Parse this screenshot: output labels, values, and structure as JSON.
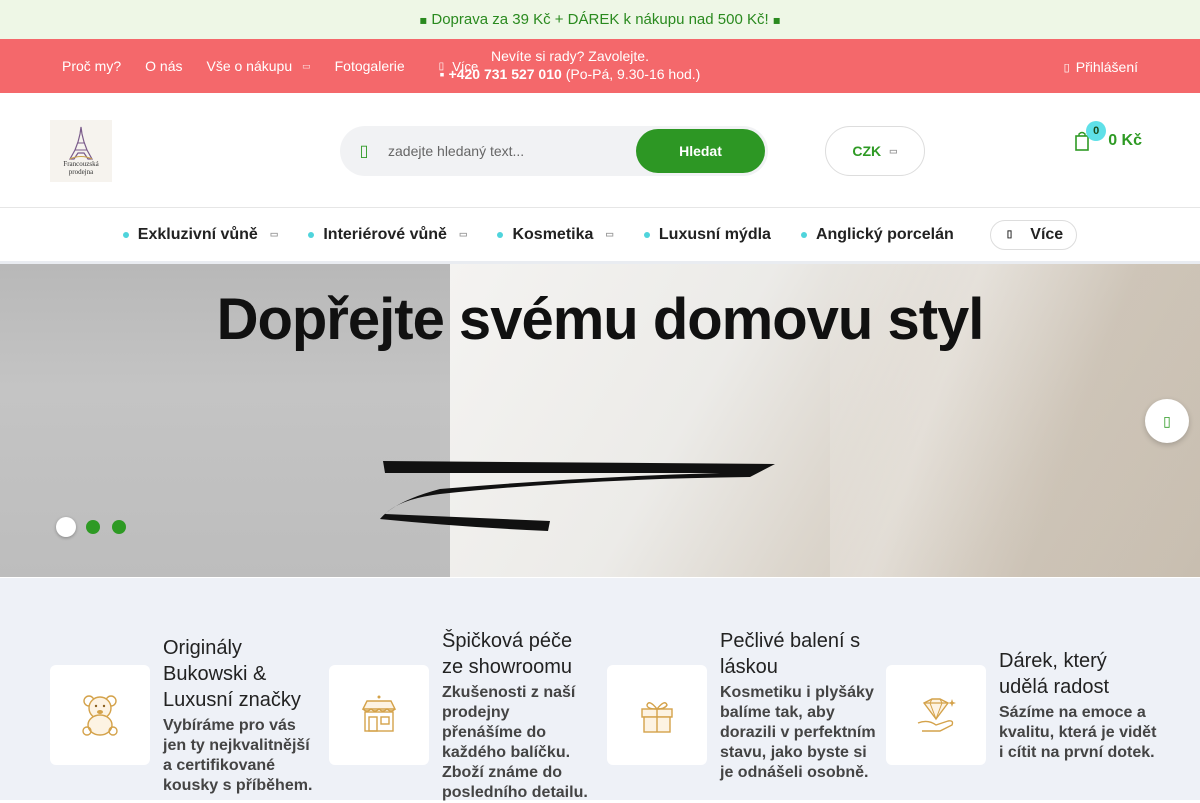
{
  "announcement": {
    "text": "Doprava za 39 Kč + DÁREK k nákupu nad 500 Kč!",
    "icon_left": "gift-icon",
    "icon_right": "gift-icon"
  },
  "topnav": {
    "links": [
      "Proč my?",
      "O nás",
      "Vše o nákupu",
      "Fotogalerie"
    ],
    "more_label": "Více",
    "phone_prompt": "Nevíte si rady? Zavolejte.",
    "phone_number": "+420 731 527 010",
    "phone_hours": "(Po-Pá, 9.30-16 hod.)",
    "login_label": "Přihlášení"
  },
  "header": {
    "logo_text_1": "Francouzská",
    "logo_text_2": "prodejna",
    "search_placeholder": "zadejte hledaný text...",
    "search_button": "Hledat",
    "currency": "CZK",
    "cart_count": "0",
    "cart_total": "0 Kč"
  },
  "categories": {
    "items": [
      {
        "label": "Exkluzivní vůně",
        "dropdown": true
      },
      {
        "label": "Interiérové vůně",
        "dropdown": true
      },
      {
        "label": "Kosmetika",
        "dropdown": true
      },
      {
        "label": "Luxusní mýdla",
        "dropdown": false
      },
      {
        "label": "Anglický porcelán",
        "dropdown": false
      }
    ],
    "more_label": "Více"
  },
  "banner": {
    "headline": "Dopřejte svému domovu styl",
    "slide_count": 3,
    "active_slide": 1
  },
  "benefits": [
    {
      "title": "Originály Bukowski & Luxusní značky",
      "text": "Vybíráme pro vás jen ty nejkvalitnější a certifikované kousky s příběhem.",
      "icon": "teddy-bear-icon"
    },
    {
      "title": "Špičková péče ze showroomu",
      "text": "Zkušenosti z naší prodejny přenášíme do každého balíčku. Zboží známe do posledního detailu.",
      "icon": "shop-icon"
    },
    {
      "title": "Pečlivé balení s láskou",
      "text": "Kosmetiku i plyšáky balíme tak, aby dorazili v perfektním stavu, jako byste si je odnášeli osobně.",
      "icon": "gift-box-icon"
    },
    {
      "title": "Dárek, který udělá radost",
      "text": "Sázíme na emoce a kvalitu, která je vidět i cítit na první dotek.",
      "icon": "diamond-hand-icon"
    }
  ],
  "colors": {
    "brand_green": "#2d9724",
    "top_red": "#f4686b",
    "accent_cyan": "#4fd4dc",
    "benefits_bg": "#eef1f7"
  }
}
